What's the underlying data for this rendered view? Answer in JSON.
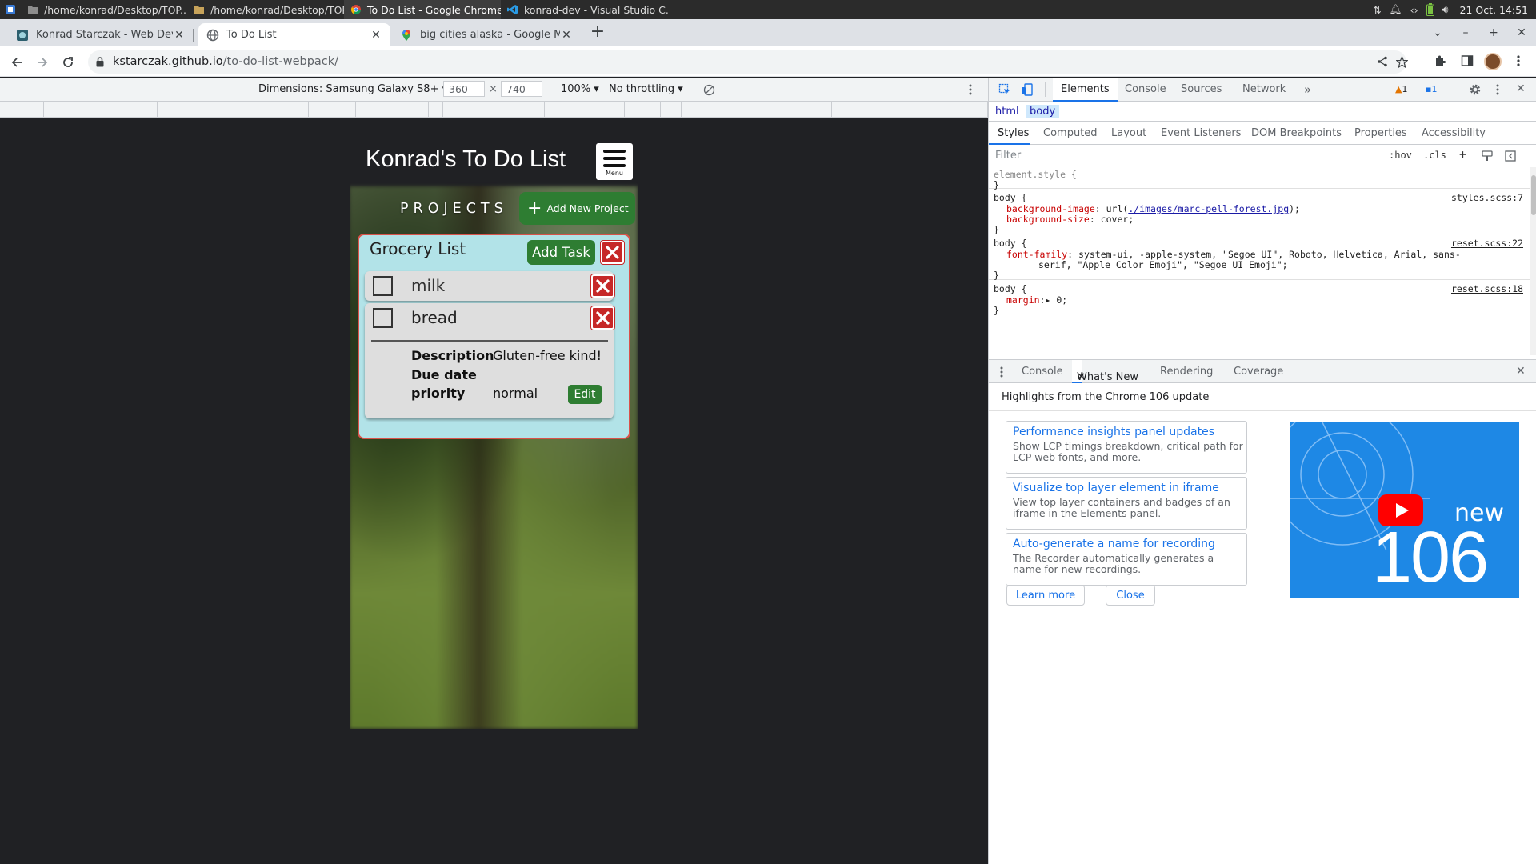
{
  "taskbar": {
    "tasks": [
      {
        "label": "/home/konrad/Desktop/TOP..."
      },
      {
        "label": "/home/konrad/Desktop/TOP..."
      },
      {
        "label": "To Do List - Google Chrome"
      },
      {
        "label": "konrad-dev - Visual Studio C..."
      }
    ],
    "clock": "21 Oct, 14:51"
  },
  "tabs": [
    {
      "label": "Konrad Starczak - Web Developer",
      "icon": "site-favicon"
    },
    {
      "label": "To Do List",
      "icon": "globe-icon"
    },
    {
      "label": "big cities alaska - Google Maps",
      "icon": "maps-icon"
    }
  ],
  "toolbar": {
    "url_host": "kstarczak.github.io",
    "url_path": "/to-do-list-webpack/"
  },
  "device_bar": {
    "dimensions": "Dimensions: Samsung Galaxy S8+",
    "width": "360",
    "height": "740",
    "times": "×",
    "zoom": "100%",
    "throttling": "No throttling"
  },
  "app": {
    "title": "Konrad's To Do List",
    "menu_label": "Menu",
    "projects_label": "PROJECTS",
    "add_project": "Add New Project",
    "project": {
      "title": "Grocery List",
      "add_task": "Add Task",
      "tasks": [
        {
          "name": "milk"
        },
        {
          "name": "bread",
          "details": [
            {
              "key": "Description",
              "value": "Gluten-free kind!"
            },
            {
              "key": "Due date",
              "value": ""
            },
            {
              "key": "priority",
              "value": "normal"
            }
          ],
          "edit": "Edit"
        }
      ]
    }
  },
  "devtools": {
    "tabs": [
      "Elements",
      "Console",
      "Sources",
      "Network"
    ],
    "more": "»",
    "warn_count": "1",
    "msg_count": "1",
    "breadcrumbs": [
      "html",
      "body"
    ],
    "style_tabs": [
      "Styles",
      "Computed",
      "Layout",
      "Event Listeners",
      "DOM Breakpoints",
      "Properties",
      "Accessibility"
    ],
    "filter_placeholder": "Filter",
    "hov": ":hov",
    "cls": ".cls",
    "rules": {
      "element_style": "element.style {",
      "close": "}",
      "body1_sel": "body {",
      "body1_src": "styles.scss:7",
      "body1_p1": "background-image",
      "body1_v1_pre": ": url(",
      "body1_v1_link": "./images/marc-pell-forest.jpg",
      "body1_v1_post": ");",
      "body1_p2": "background-size",
      "body1_v2": ": cover;",
      "body2_sel": "body {",
      "body2_src": "reset.scss:22",
      "body2_p1": "font-family",
      "body2_v1": ": system-ui, -apple-system, \"Segoe UI\", Roboto, Helvetica, Arial, sans-",
      "body2_v1b": "serif, \"Apple Color Emoji\", \"Segoe UI Emoji\";",
      "body3_sel": "body {",
      "body3_src": "reset.scss:18",
      "body3_p1": "margin",
      "body3_v1": ":▸ 0;"
    },
    "drawer_tabs": [
      "Console",
      "What's New",
      "Rendering",
      "Coverage"
    ],
    "highlights_title": "Highlights from the Chrome 106 update",
    "cards": [
      {
        "title": "Performance insights panel updates",
        "desc": "Show LCP timings breakdown, critical path for LCP web fonts, and more."
      },
      {
        "title": "Visualize top layer element in iframe",
        "desc": "View top layer containers and badges of an iframe in the Elements panel."
      },
      {
        "title": "Auto-generate a name for recording",
        "desc": "The Recorder automatically generates a name for new recordings."
      }
    ],
    "video_new": "new",
    "video_num": "106",
    "learn_more": "Learn more",
    "close": "Close"
  }
}
